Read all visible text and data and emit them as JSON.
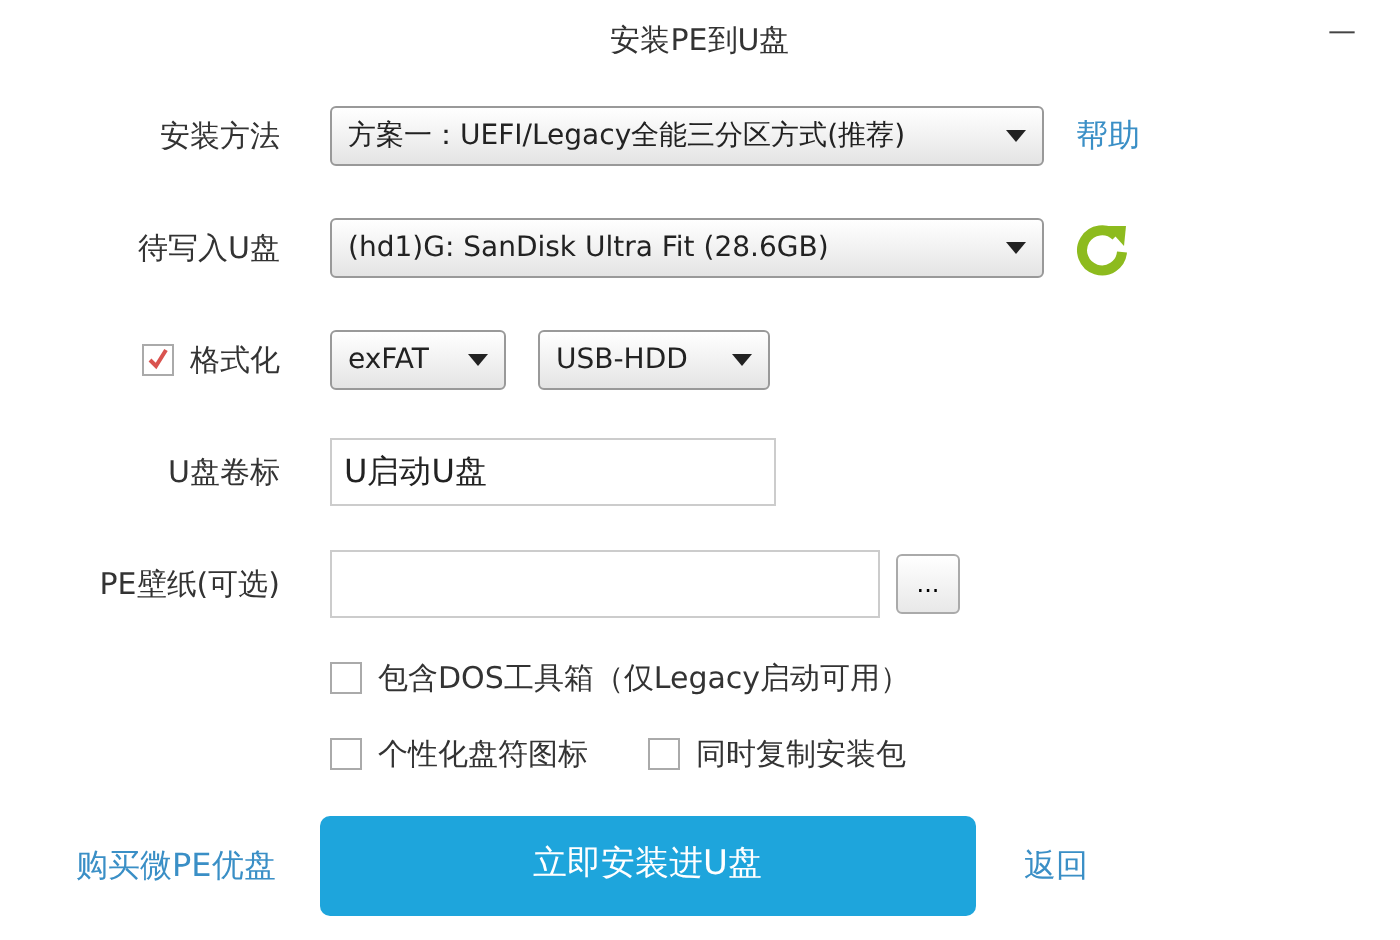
{
  "window": {
    "title": "安装PE到U盘",
    "minimize": "—"
  },
  "fields": [
    {
      "kind": "select",
      "label": "安装方法",
      "value": "方案一：UEFI/Legacy全能三分区方式(推荐)",
      "link": "帮助"
    },
    {
      "kind": "drive",
      "label": "待写入U盘",
      "value": "(hd1)G: SanDisk Ultra Fit (28.6GB)"
    },
    {
      "kind": "format",
      "label": "格式化",
      "checked": true,
      "selects": [
        "exFAT",
        "USB-HDD"
      ]
    },
    {
      "kind": "text",
      "label": "U盘卷标",
      "value": "U启动U盘"
    },
    {
      "kind": "file",
      "label": "PE壁纸(可选)",
      "browse": "..."
    }
  ],
  "options": [
    [
      {
        "label": "包含DOS工具箱（仅Legacy启动可用）",
        "checked": false
      }
    ],
    [
      {
        "label": "个性化盘符图标",
        "checked": false
      },
      {
        "label": "同时复制安装包",
        "checked": false
      }
    ]
  ],
  "footer": {
    "buy_link": "购买微PE优盘",
    "install_button": "立即安装进U盘",
    "back_link": "返回"
  }
}
